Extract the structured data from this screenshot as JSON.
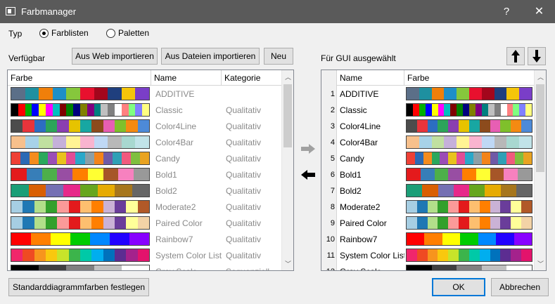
{
  "window": {
    "title": "Farbmanager",
    "help": "?",
    "close": "✕"
  },
  "type_label": "Typ",
  "radio": {
    "farblisten": "Farblisten",
    "paletten": "Paletten"
  },
  "available_label": "Verfügbar",
  "buttons": {
    "web_import": "Aus Web importieren",
    "file_import": "Aus Dateien importieren",
    "new": "Neu",
    "set_default": "Standarddiagrammfarben festlegen",
    "ok": "OK",
    "cancel": "Abbrechen"
  },
  "selected_label": "Für GUI ausgewählt",
  "left_headers": {
    "color": "Farbe",
    "name": "Name",
    "category": "Kategorie"
  },
  "right_headers": {
    "name": "Name",
    "color": "Farbe"
  },
  "icons": {
    "move_up": "arrow-up-icon",
    "move_down": "arrow-down-icon",
    "add": "arrow-right-icon",
    "remove": "arrow-left-icon"
  },
  "palettes": [
    {
      "name": "ADDITIVE",
      "category": "",
      "colors": [
        "#5b6f88",
        "#1e90a0",
        "#f07f0a",
        "#1e8fc8",
        "#86c73c",
        "#e8102e",
        "#a3061c",
        "#1f3f7e",
        "#f5c50a",
        "#7a3ec8"
      ]
    },
    {
      "name": "Classic",
      "category": "Qualitativ",
      "colors": [
        "#000000",
        "#ff0000",
        "#00b000",
        "#0000ff",
        "#ffff00",
        "#ff00ff",
        "#00c0c0",
        "#800000",
        "#008000",
        "#000080",
        "#808000",
        "#800080",
        "#008080",
        "#c0c0c0",
        "#808080",
        "#ffffff",
        "#ff8080",
        "#80ff80",
        "#8080ff",
        "#ffff80"
      ]
    },
    {
      "name": "Color4Line",
      "category": "Qualitativ",
      "colors": [
        "#4c4c4c",
        "#e8343b",
        "#2c6ec2",
        "#2ca45a",
        "#8a3fb0",
        "#e6c300",
        "#18a7a2",
        "#8c4b1c",
        "#e75fb3",
        "#7fc02b",
        "#f48a12",
        "#4d8ad8"
      ]
    },
    {
      "name": "Color4Bar",
      "category": "Qualitativ",
      "colors": [
        "#f7c08c",
        "#a7d2e8",
        "#c0e0a0",
        "#c5b0da",
        "#fff494",
        "#f9b4cf",
        "#bfd8f5",
        "#b8b8b8",
        "#a8d8d0",
        "#c1e3e8"
      ]
    },
    {
      "name": "Candy",
      "category": "Qualitativ",
      "colors": [
        "#ee4035",
        "#2b6ab5",
        "#f48c1e",
        "#2aa85c",
        "#9b4db6",
        "#e8c21c",
        "#e14d96",
        "#2aa8c9",
        "#8c9fa6",
        "#f3841a",
        "#6f5aa6",
        "#2fa0b6",
        "#f05a7e",
        "#7fbf3f",
        "#e9a321"
      ]
    },
    {
      "name": "Bold1",
      "category": "Qualitativ",
      "colors": [
        "#e41a1c",
        "#377eb8",
        "#4daf4a",
        "#984ea3",
        "#ff7f00",
        "#ffff33",
        "#a65628",
        "#f781bf",
        "#999999"
      ]
    },
    {
      "name": "Bold2",
      "category": "Qualitativ",
      "colors": [
        "#1b9e77",
        "#d95f02",
        "#7570b3",
        "#e7298a",
        "#66a61e",
        "#e6ab02",
        "#a6761d",
        "#666666"
      ]
    },
    {
      "name": "Moderate2",
      "category": "Qualitativ",
      "colors": [
        "#a6cee3",
        "#1f78b4",
        "#b2df8a",
        "#33a02c",
        "#fb9a99",
        "#e31a1c",
        "#fdbf6f",
        "#ff7f00",
        "#cab2d6",
        "#6a3d9a",
        "#ffff99",
        "#b15928"
      ]
    },
    {
      "name": "Paired Color",
      "category": "Qualitativ",
      "colors": [
        "#a6cee3",
        "#1f78b4",
        "#b2df8a",
        "#33a02c",
        "#fb9a99",
        "#e31a1c",
        "#fdbf6f",
        "#ff7f00",
        "#cab2d6",
        "#6a3d9a",
        "#ffff99",
        "#f3d3a6"
      ]
    },
    {
      "name": "Rainbow7",
      "category": "Qualitativ",
      "colors": [
        "#ff0000",
        "#ff7f00",
        "#ffff00",
        "#00cc00",
        "#0088ff",
        "#2200ff",
        "#8800ff"
      ]
    },
    {
      "name": "System Color List",
      "category": "Qualitativ",
      "colors": [
        "#f0266b",
        "#ef4a23",
        "#f7941d",
        "#f9c80e",
        "#c7e42a",
        "#3cb44b",
        "#00c9a7",
        "#00aeef",
        "#0072bc",
        "#5c2d91",
        "#a4228c",
        "#e3136c"
      ]
    },
    {
      "name": "Gray Scale",
      "category": "Sequenziell",
      "colors": [
        "#000000",
        "#404040",
        "#808080",
        "#c0c0c0",
        "#ffffff"
      ]
    }
  ]
}
